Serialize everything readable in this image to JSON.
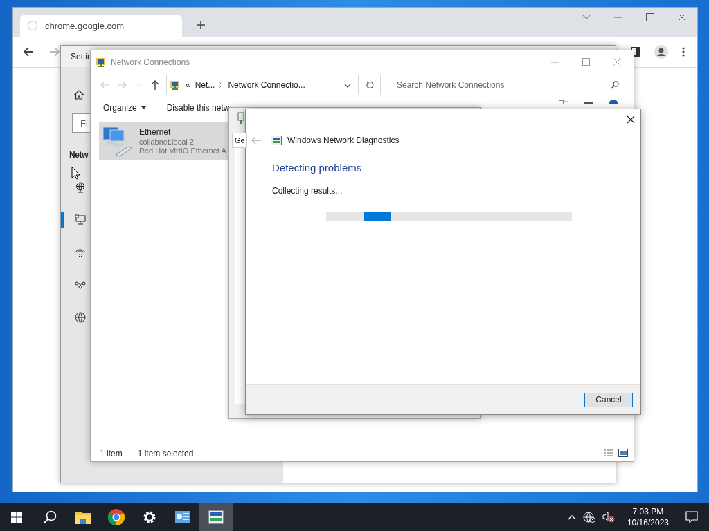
{
  "browser": {
    "tab": {
      "title": "chrome.google.com",
      "loading": true
    }
  },
  "settings_window": {
    "title": "Settin",
    "find_placeholder": "Fi",
    "heading": "Netw",
    "nav_items": [
      {
        "kind": "status",
        "selected": false
      },
      {
        "kind": "ethernet",
        "selected": true
      },
      {
        "kind": "dialup",
        "selected": false
      },
      {
        "kind": "vpn",
        "selected": false
      },
      {
        "kind": "proxy",
        "selected": false
      }
    ]
  },
  "network_connections": {
    "title": "Network Connections",
    "breadcrumb_lead": "«",
    "breadcrumb": [
      "Net...",
      "Network Connectio..."
    ],
    "search_placeholder": "Search Network Connections",
    "commands": [
      {
        "label": "Organize",
        "kind": "menu"
      },
      {
        "label": "Disable this netw",
        "kind": "plain"
      }
    ],
    "items": [
      {
        "name": "Ethernet",
        "network": "collabnet.local 2",
        "device": "Red Hat VirtIO Ethernet A",
        "selected": true
      }
    ],
    "status": [
      "1 item",
      "1 item selected"
    ]
  },
  "properties_window": {
    "tab": "Ge"
  },
  "diagnostics": {
    "title": "Windows Network Diagnostics",
    "heading": "Detecting problems",
    "status": "Collecting results...",
    "buttons": [
      "Cancel"
    ]
  },
  "taskbar": {
    "apps": [
      {
        "kind": "explorer",
        "active": false
      },
      {
        "kind": "chrome",
        "active": false
      },
      {
        "kind": "settings",
        "active": false
      },
      {
        "kind": "control-panel",
        "active": false
      },
      {
        "kind": "diagnostics",
        "active": true
      }
    ],
    "time": "7:03 PM",
    "date": "10/16/2023"
  }
}
